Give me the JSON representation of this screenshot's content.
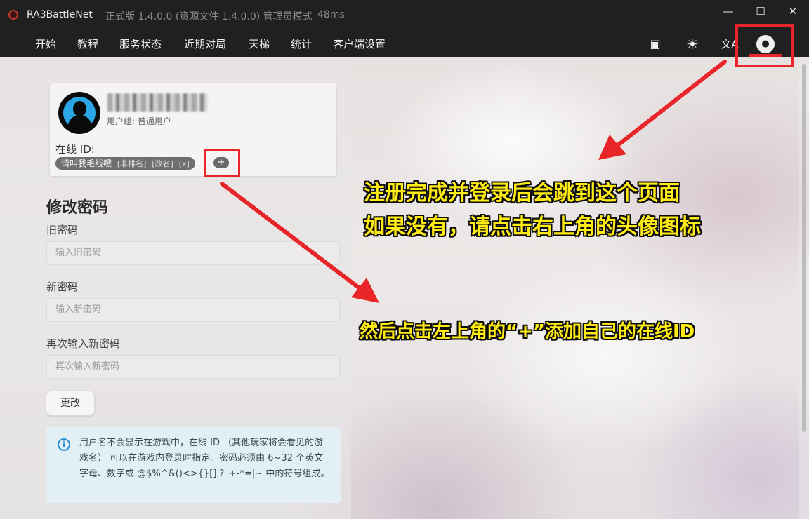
{
  "titlebar": {
    "app_name": "RA3BattleNet",
    "version": "正式版 1.4.0.0 (资源文件 1.4.0.0) 管理员模式",
    "ping": "48ms",
    "minimize": "—",
    "maximize": "☐",
    "close": "✕"
  },
  "nav": {
    "items": [
      "开始",
      "教程",
      "服务状态",
      "近期对局",
      "天梯",
      "统计",
      "客户端设置"
    ],
    "icons": [
      "bilibili-icon",
      "sun-icon",
      "translate-icon",
      "user-icon"
    ],
    "icon_glyphs": {
      "bilibili": "▣",
      "sun": "☀",
      "translate": "文A",
      "user": "●"
    }
  },
  "profile": {
    "user_group": "用户组: 普通用户",
    "online_id_label": "在线 ID:",
    "online_id": "请叫我毛线哦",
    "id_actions": [
      "[非排名]",
      "[改名]",
      "[x]"
    ],
    "add_button": "+"
  },
  "password_form": {
    "title": "修改密码",
    "old_label": "旧密码",
    "old_placeholder": "输入旧密码",
    "new_label": "新密码",
    "new_placeholder": "输入新密码",
    "repeat_label": "再次输入新密码",
    "repeat_placeholder": "再次输入新密码",
    "submit": "更改"
  },
  "info": {
    "icon": "i",
    "text": "用户名不会显示在游戏中，在线 ID （其他玩家将会看见的游戏名） 可以在游戏内登录时指定。密码必须由 6~32 个英文字母、数字或 @$%^&()<>{}[].?_+-*=|~ 中的符号组成。"
  },
  "annotations": {
    "line1": "注册完成并登录后会跳到这个页面",
    "line2": "如果没有，请点击右上角的头像图标",
    "line3": "然后点击左上角的“+”添加自己的在线ID"
  },
  "colors": {
    "titlebar_bg": "#202020",
    "highlight_red": "#e8262a",
    "annotation_yellow": "#ffeb14",
    "avatar_blue": "#2aa6e6",
    "info_blue": "#2b91d0"
  }
}
